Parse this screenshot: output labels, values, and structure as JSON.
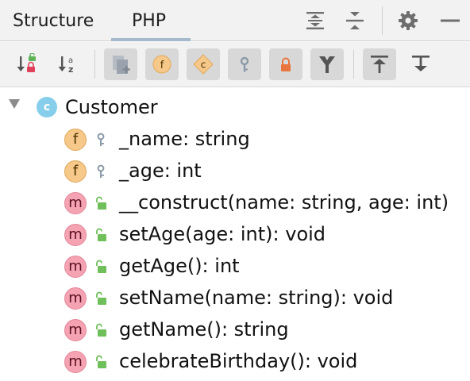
{
  "tabs": [
    {
      "label": "Structure",
      "selected": false
    },
    {
      "label": "PHP",
      "selected": true
    }
  ],
  "header_icons": [
    "expand-all-icon",
    "collapse-all-icon",
    "gear-icon",
    "minimize-icon"
  ],
  "toolbar": {
    "buttons": [
      {
        "name": "sort-by-visibility-icon",
        "active": false
      },
      {
        "name": "sort-alphabetically-icon",
        "active": false
      },
      {
        "name": "show-inherited-icon",
        "active": true
      },
      {
        "name": "show-fields-icon",
        "active": true
      },
      {
        "name": "show-constants-icon",
        "active": true
      },
      {
        "name": "show-non-public-icon",
        "active": true
      },
      {
        "name": "show-private-icon",
        "active": true
      },
      {
        "name": "show-includes-icon",
        "active": true
      },
      {
        "name": "autoscroll-to-source-icon",
        "active": true
      },
      {
        "name": "autoscroll-from-source-icon",
        "active": false
      }
    ]
  },
  "tree": {
    "root": {
      "label": "Customer",
      "badge": "c",
      "expanded": true
    },
    "members": [
      {
        "kind": "field",
        "badge": "f",
        "access": "private",
        "label": "_name: string"
      },
      {
        "kind": "field",
        "badge": "f",
        "access": "private",
        "label": "_age: int"
      },
      {
        "kind": "method",
        "badge": "m",
        "access": "public",
        "label": "__construct(name: string, age: int)"
      },
      {
        "kind": "method",
        "badge": "m",
        "access": "public",
        "label": "setAge(age: int): void"
      },
      {
        "kind": "method",
        "badge": "m",
        "access": "public",
        "label": "getAge(): int"
      },
      {
        "kind": "method",
        "badge": "m",
        "access": "public",
        "label": "setName(name: string): void"
      },
      {
        "kind": "method",
        "badge": "m",
        "access": "public",
        "label": "getName(): string"
      },
      {
        "kind": "method",
        "badge": "m",
        "access": "public",
        "label": "celebrateBirthday(): void"
      }
    ]
  },
  "colors": {
    "field_badge": "#f6c98a",
    "method_badge": "#f5a3b3",
    "class_badge": "#87ceeb",
    "public_lock": "#6fbf5a",
    "private_key": "#8a9aa8",
    "toolbar_active": "#d8d8d8"
  }
}
